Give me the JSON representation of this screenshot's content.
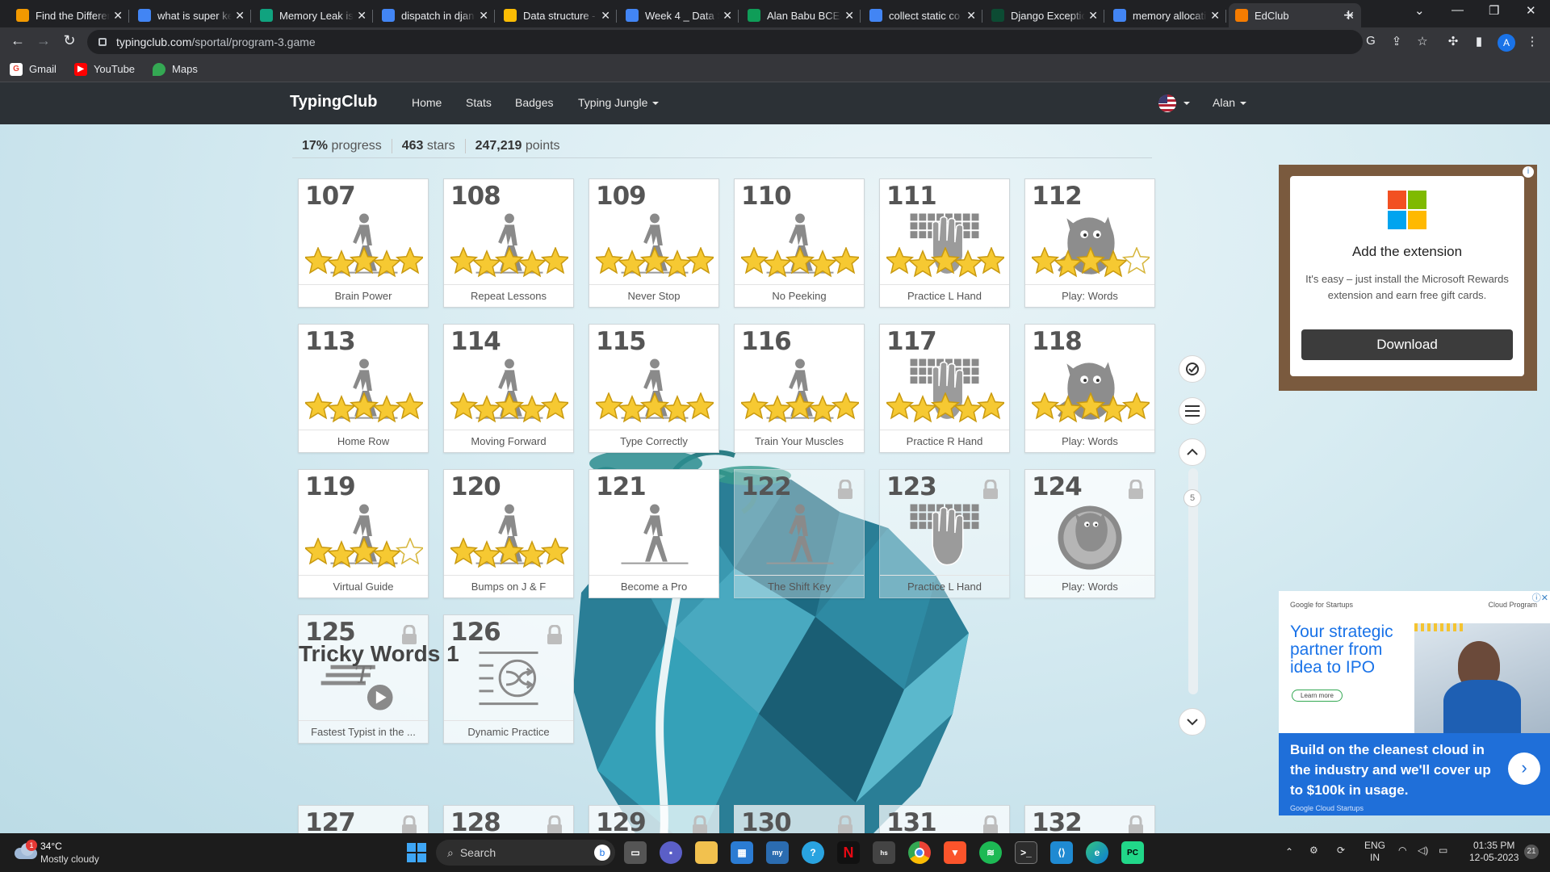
{
  "browser": {
    "tabs": [
      {
        "title": "Find the Differen",
        "icon": "tab-favicon-generic",
        "color": "#f29900"
      },
      {
        "title": "what is super ke",
        "icon": "google-icon",
        "color": "#4285f4"
      },
      {
        "title": "Memory Leak is",
        "icon": "chatgpt-icon",
        "color": "#10a37f"
      },
      {
        "title": "dispatch in djan",
        "icon": "google-icon",
        "color": "#4285f4"
      },
      {
        "title": "Data structure -",
        "icon": "google-drive-icon",
        "color": "#fbbc04"
      },
      {
        "title": "Week 4 _ Data S",
        "icon": "google-docs-icon",
        "color": "#4285f4"
      },
      {
        "title": "Alan Babu BCE8",
        "icon": "google-sheets-icon",
        "color": "#0f9d58"
      },
      {
        "title": "collect static co",
        "icon": "google-icon",
        "color": "#4285f4"
      },
      {
        "title": "Django Exceptio",
        "icon": "django-icon",
        "color": "#0c4b33"
      },
      {
        "title": "memory allocati",
        "icon": "google-icon",
        "color": "#4285f4"
      },
      {
        "title": "EdClub",
        "icon": "edclub-icon",
        "color": "#f57c00"
      }
    ],
    "url_host": "typingclub.com",
    "url_path": "/sportal/program-3.game",
    "profile_initial": "A",
    "bookmarks": [
      {
        "label": "Gmail",
        "icon": "google-icon"
      },
      {
        "label": "YouTube",
        "icon": "youtube-icon"
      },
      {
        "label": "Maps",
        "icon": "maps-icon"
      }
    ]
  },
  "site": {
    "brand": "TypingClub",
    "nav": {
      "home": "Home",
      "stats": "Stats",
      "badges": "Badges",
      "jungle": "Typing Jungle",
      "user": "Alan"
    },
    "stats": {
      "progress_value": "17%",
      "progress_label": "progress",
      "stars_value": "463",
      "stars_label": "stars",
      "points_value": "247,219",
      "points_label": "points"
    },
    "lessons": [
      {
        "num": "107",
        "name": "Brain Power",
        "art": "walker",
        "stars": 5,
        "locked": false
      },
      {
        "num": "108",
        "name": "Repeat Lessons",
        "art": "walker",
        "stars": 5,
        "locked": false
      },
      {
        "num": "109",
        "name": "Never Stop",
        "art": "walker",
        "stars": 5,
        "locked": false
      },
      {
        "num": "110",
        "name": "No Peeking",
        "art": "walker",
        "stars": 5,
        "locked": false
      },
      {
        "num": "111",
        "name": "Practice L Hand",
        "art": "hand",
        "stars": 5,
        "locked": false
      },
      {
        "num": "112",
        "name": "Play: Words",
        "art": "monster",
        "stars": 4,
        "locked": false
      },
      {
        "num": "113",
        "name": "Home Row",
        "art": "walker",
        "stars": 5,
        "locked": false
      },
      {
        "num": "114",
        "name": "Moving Forward",
        "art": "walker",
        "stars": 5,
        "locked": false
      },
      {
        "num": "115",
        "name": "Type Correctly",
        "art": "walker",
        "stars": 5,
        "locked": false
      },
      {
        "num": "116",
        "name": "Train Your Muscles",
        "art": "walker",
        "stars": 5,
        "locked": false
      },
      {
        "num": "117",
        "name": "Practice R Hand",
        "art": "hand",
        "stars": 5,
        "locked": false
      },
      {
        "num": "118",
        "name": "Play: Words",
        "art": "monster",
        "stars": 5,
        "locked": false
      },
      {
        "num": "119",
        "name": "Virtual Guide",
        "art": "walker",
        "stars": 4,
        "locked": false
      },
      {
        "num": "120",
        "name": "Bumps on J & F",
        "art": "walker",
        "stars": 5,
        "locked": false
      },
      {
        "num": "121",
        "name": "Become a Pro",
        "art": "walker",
        "stars": 0,
        "locked": false
      },
      {
        "num": "122",
        "name": "The Shift Key",
        "art": "walker",
        "stars": 0,
        "locked": true
      },
      {
        "num": "123",
        "name": "Practice L Hand",
        "art": "hand",
        "stars": 0,
        "locked": true
      },
      {
        "num": "124",
        "name": "Play: Words",
        "art": "monster-circle",
        "stars": 0,
        "locked": true
      },
      {
        "num": "125",
        "name": "Fastest Typist in the ...",
        "art": "speed",
        "stars": 0,
        "locked": true
      },
      {
        "num": "126",
        "name": "Dynamic Practice",
        "art": "shuffle",
        "stars": 0,
        "locked": true
      }
    ],
    "section_title": "Tricky Words 1",
    "next_lessons": [
      "127",
      "128",
      "129",
      "130",
      "131",
      "132"
    ],
    "scroll_badge": "5"
  },
  "ads": {
    "ad1": {
      "title": "Add the extension",
      "body": "It's easy – just install the Microsoft Rewards extension and earn free gift cards.",
      "button": "Download"
    },
    "ad2": {
      "brand": "Google for Startups",
      "program": "Cloud Program",
      "headline": "Your strategic partner from idea to IPO",
      "learn": "Learn more",
      "body": "Build on the cleanest cloud in the industry and we'll cover up to $100k in usage.",
      "footer": "Google Cloud Startups"
    }
  },
  "taskbar": {
    "weather_temp": "34°C",
    "weather_desc": "Mostly cloudy",
    "weather_badge": "1",
    "search": "Search",
    "lang1": "ENG",
    "lang2": "IN",
    "time": "01:35 PM",
    "date": "12-05-2023",
    "notif": "21"
  }
}
